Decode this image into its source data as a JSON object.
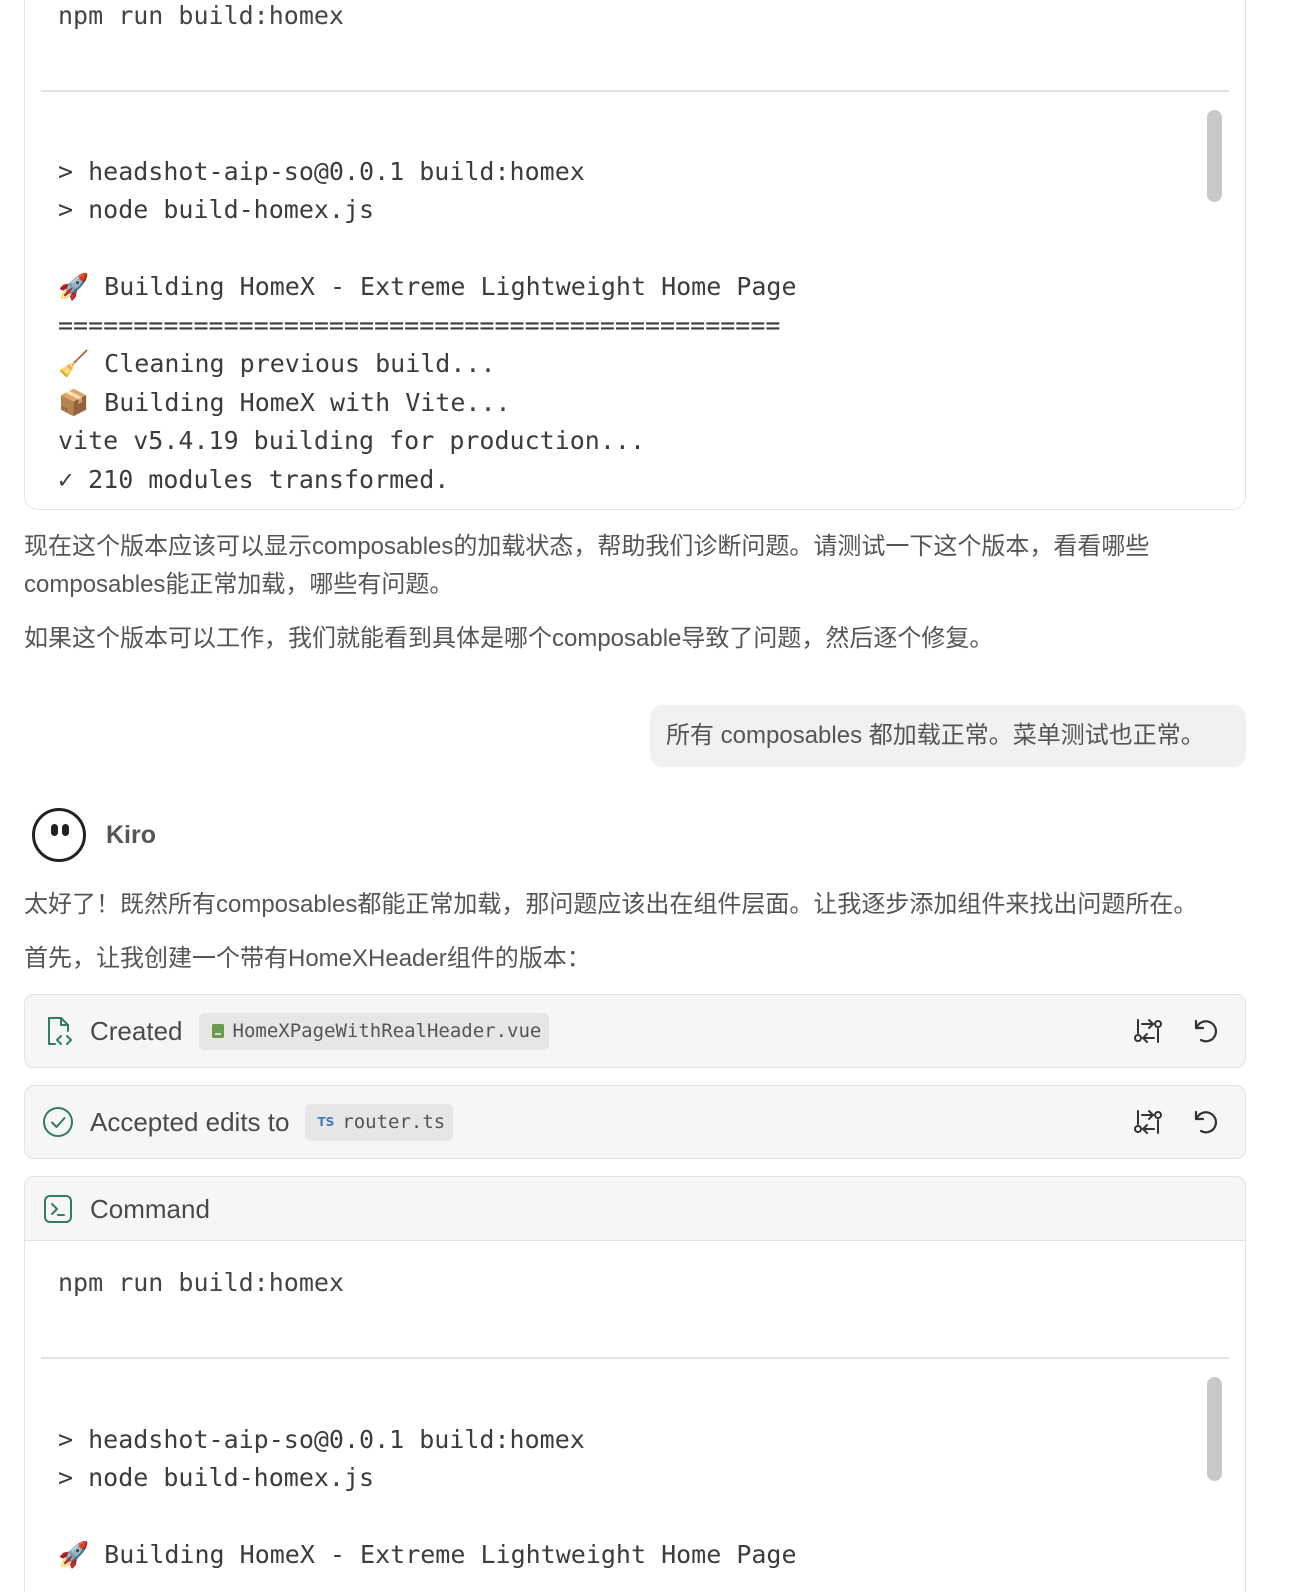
{
  "top_terminal": {
    "command": "npm run build:homex",
    "output_lines": [
      "",
      "> headshot-aip-so@0.0.1 build:homex",
      "> node build-homex.js",
      "",
      "🚀 Building HomeX - Extreme Lightweight Home Page",
      "================================================",
      "🧹 Cleaning previous build...",
      "📦 Building HomeX with Vite...",
      "vite v5.4.19 building for production...",
      "✓ 210 modules transformed."
    ]
  },
  "assistant_message_1": {
    "paragraph_1_line_1": "现在这个版本应该可以显示composables的加载状态，帮助我们诊断问题。请测试一下这个版本，看看哪些",
    "paragraph_1_line_2": "composables能正常加载，哪些有问题。",
    "paragraph_2": "如果这个版本可以工作，我们就能看到具体是哪个composable导致了问题，然后逐个修复。"
  },
  "user_message": {
    "text": "所有 composables 都加载正常。菜单测试也正常。"
  },
  "assistant": {
    "name": "Kiro",
    "paragraph_1": "太好了！既然所有composables都能正常加载，那问题应该出在组件层面。让我逐步添加组件来找出问题所在。",
    "paragraph_2": "首先，让我创建一个带有HomeXHeader组件的版本："
  },
  "actions": {
    "created": {
      "label": "Created",
      "file": "HomeXPageWithRealHeader.vue",
      "icon": "file-code-icon",
      "file_icon": "vue-file-icon"
    },
    "accepted": {
      "label": "Accepted edits to",
      "file": "router.ts",
      "file_badge": "TS",
      "icon": "check-circle-icon"
    }
  },
  "command_block": {
    "header": "Command",
    "icon": "terminal-icon",
    "command": "npm run build:homex",
    "output_lines": [
      "",
      "> headshot-aip-so@0.0.1 build:homex",
      "> node build-homex.js",
      "",
      "🚀 Building HomeX - Extreme Lightweight Home Page"
    ]
  },
  "colors": {
    "accent_green": "#2f7d5b",
    "vue_green": "#6a9a4f",
    "ts_blue": "#3f7fbf"
  }
}
